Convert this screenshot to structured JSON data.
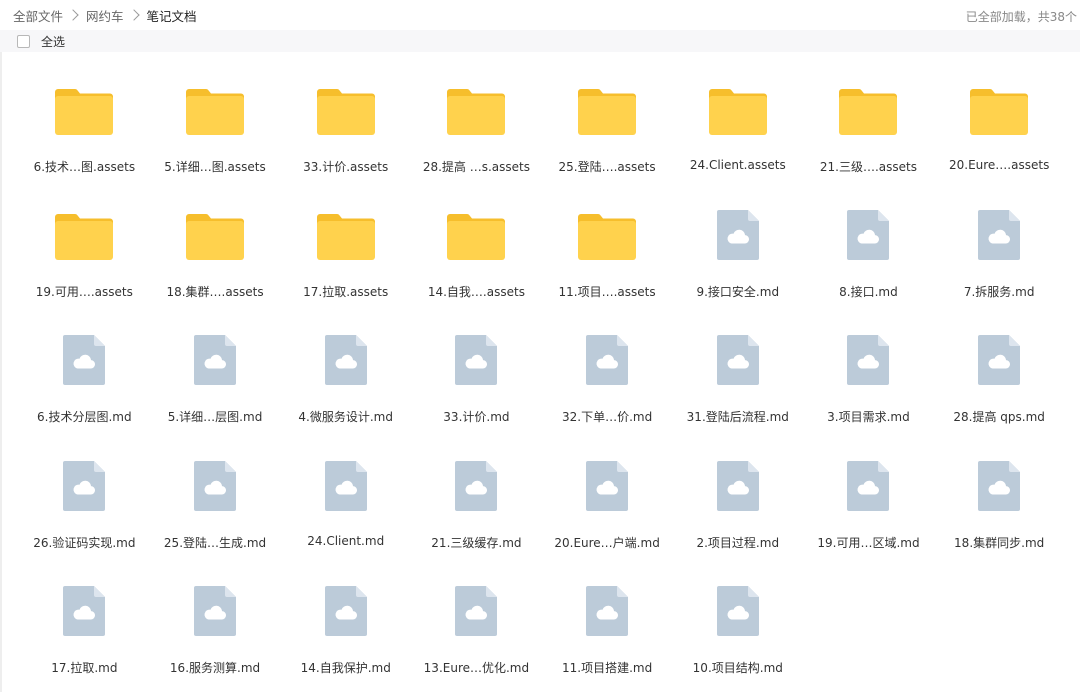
{
  "breadcrumb": [
    "全部文件",
    "网约车",
    "笔记文档"
  ],
  "status_text": "已全部加载，共38个",
  "select_all_label": "全选",
  "colors": {
    "folder": "#FFD24D",
    "folder_tab": "#F6BE2C",
    "file": "#BCCBD9",
    "file_fold": "#DDE5EE"
  },
  "items": [
    {
      "type": "folder",
      "name": "6.技术…图.assets"
    },
    {
      "type": "folder",
      "name": "5.详细…图.assets"
    },
    {
      "type": "folder",
      "name": "33.计价.assets"
    },
    {
      "type": "folder",
      "name": "28.提高 …s.assets"
    },
    {
      "type": "folder",
      "name": "25.登陆….assets"
    },
    {
      "type": "folder",
      "name": "24.Client.assets"
    },
    {
      "type": "folder",
      "name": "21.三级….assets"
    },
    {
      "type": "folder",
      "name": "20.Eure….assets"
    },
    {
      "type": "folder",
      "name": "19.可用….assets"
    },
    {
      "type": "folder",
      "name": "18.集群….assets"
    },
    {
      "type": "folder",
      "name": "17.拉取.assets"
    },
    {
      "type": "folder",
      "name": "14.自我….assets"
    },
    {
      "type": "folder",
      "name": "11.项目….assets"
    },
    {
      "type": "file",
      "name": "9.接口安全.md"
    },
    {
      "type": "file",
      "name": "8.接口.md"
    },
    {
      "type": "file",
      "name": "7.拆服务.md"
    },
    {
      "type": "file",
      "name": "6.技术分层图.md"
    },
    {
      "type": "file",
      "name": "5.详细…层图.md"
    },
    {
      "type": "file",
      "name": "4.微服务设计.md"
    },
    {
      "type": "file",
      "name": "33.计价.md"
    },
    {
      "type": "file",
      "name": "32.下单…价.md"
    },
    {
      "type": "file",
      "name": "31.登陆后流程.md"
    },
    {
      "type": "file",
      "name": "3.项目需求.md"
    },
    {
      "type": "file",
      "name": "28.提高 qps.md"
    },
    {
      "type": "file",
      "name": "26.验证码实现.md"
    },
    {
      "type": "file",
      "name": "25.登陆…生成.md"
    },
    {
      "type": "file",
      "name": "24.Client.md"
    },
    {
      "type": "file",
      "name": "21.三级缓存.md"
    },
    {
      "type": "file",
      "name": "20.Eure…户端.md"
    },
    {
      "type": "file",
      "name": "2.项目过程.md"
    },
    {
      "type": "file",
      "name": "19.可用…区域.md"
    },
    {
      "type": "file",
      "name": "18.集群同步.md"
    },
    {
      "type": "file",
      "name": "17.拉取.md"
    },
    {
      "type": "file",
      "name": "16.服务测算.md"
    },
    {
      "type": "file",
      "name": "14.自我保护.md"
    },
    {
      "type": "file",
      "name": "13.Eure…优化.md"
    },
    {
      "type": "file",
      "name": "11.项目搭建.md"
    },
    {
      "type": "file",
      "name": "10.项目结构.md"
    }
  ]
}
